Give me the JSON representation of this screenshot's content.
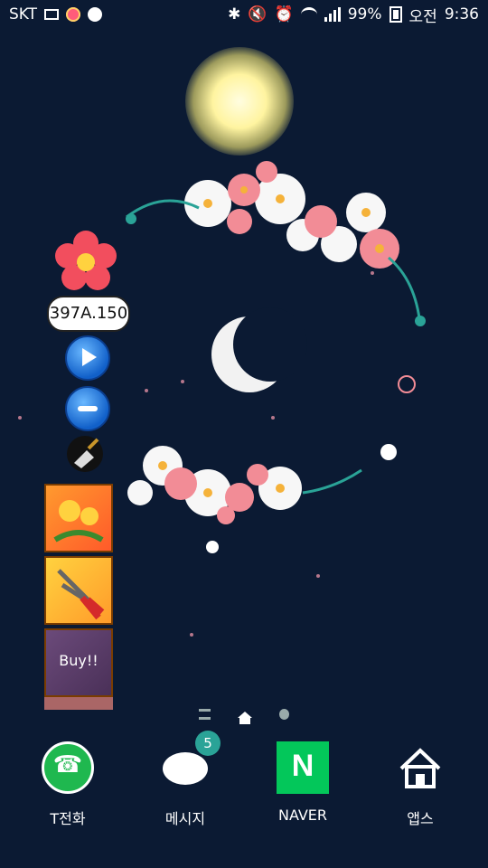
{
  "status_bar": {
    "carrier": "SKT",
    "battery": "99%",
    "time_prefix": "오전",
    "time": "9:36",
    "icons": [
      "image-icon",
      "flower-icon",
      "swirl-icon",
      "bluetooth-icon",
      "mute-icon",
      "alarm-icon",
      "wifi-icon",
      "signal-icon",
      "battery-icon"
    ]
  },
  "widget": {
    "counter": "397A.150",
    "tiles": [
      {
        "name": "dandelion-tile"
      },
      {
        "name": "shears-tile"
      },
      {
        "label": "Buy!!"
      }
    ]
  },
  "pager": {
    "pages": 3,
    "active": 1
  },
  "dock": [
    {
      "label": "T전화",
      "icon": "phone-icon"
    },
    {
      "label": "메시지",
      "icon": "message-icon",
      "badge": "5"
    },
    {
      "label": "NAVER",
      "icon": "naver-icon",
      "glyph": "N"
    },
    {
      "label": "앱스",
      "icon": "apps-home-icon"
    }
  ],
  "colors": {
    "background": "#0b1a33",
    "naver_green": "#03c75a",
    "phone_green": "#1fb84f",
    "badge_teal": "#2aa397"
  }
}
